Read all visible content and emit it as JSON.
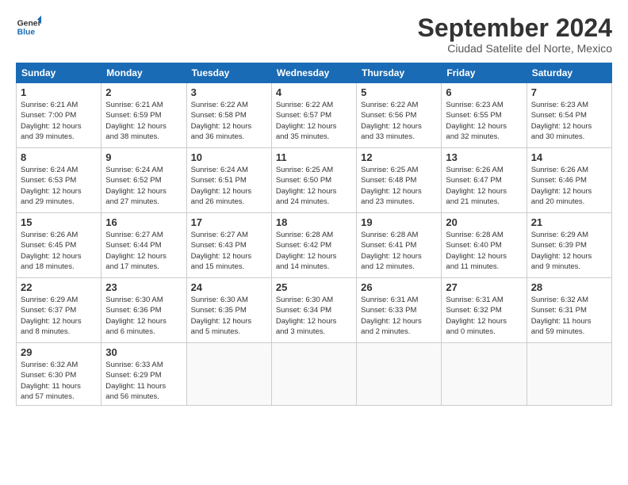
{
  "logo": {
    "line1": "General",
    "line2": "Blue"
  },
  "title": "September 2024",
  "location": "Ciudad Satelite del Norte, Mexico",
  "days_header": [
    "Sunday",
    "Monday",
    "Tuesday",
    "Wednesday",
    "Thursday",
    "Friday",
    "Saturday"
  ],
  "weeks": [
    [
      {
        "num": "1",
        "info": "Sunrise: 6:21 AM\nSunset: 7:00 PM\nDaylight: 12 hours\nand 39 minutes."
      },
      {
        "num": "2",
        "info": "Sunrise: 6:21 AM\nSunset: 6:59 PM\nDaylight: 12 hours\nand 38 minutes."
      },
      {
        "num": "3",
        "info": "Sunrise: 6:22 AM\nSunset: 6:58 PM\nDaylight: 12 hours\nand 36 minutes."
      },
      {
        "num": "4",
        "info": "Sunrise: 6:22 AM\nSunset: 6:57 PM\nDaylight: 12 hours\nand 35 minutes."
      },
      {
        "num": "5",
        "info": "Sunrise: 6:22 AM\nSunset: 6:56 PM\nDaylight: 12 hours\nand 33 minutes."
      },
      {
        "num": "6",
        "info": "Sunrise: 6:23 AM\nSunset: 6:55 PM\nDaylight: 12 hours\nand 32 minutes."
      },
      {
        "num": "7",
        "info": "Sunrise: 6:23 AM\nSunset: 6:54 PM\nDaylight: 12 hours\nand 30 minutes."
      }
    ],
    [
      {
        "num": "8",
        "info": "Sunrise: 6:24 AM\nSunset: 6:53 PM\nDaylight: 12 hours\nand 29 minutes."
      },
      {
        "num": "9",
        "info": "Sunrise: 6:24 AM\nSunset: 6:52 PM\nDaylight: 12 hours\nand 27 minutes."
      },
      {
        "num": "10",
        "info": "Sunrise: 6:24 AM\nSunset: 6:51 PM\nDaylight: 12 hours\nand 26 minutes."
      },
      {
        "num": "11",
        "info": "Sunrise: 6:25 AM\nSunset: 6:50 PM\nDaylight: 12 hours\nand 24 minutes."
      },
      {
        "num": "12",
        "info": "Sunrise: 6:25 AM\nSunset: 6:48 PM\nDaylight: 12 hours\nand 23 minutes."
      },
      {
        "num": "13",
        "info": "Sunrise: 6:26 AM\nSunset: 6:47 PM\nDaylight: 12 hours\nand 21 minutes."
      },
      {
        "num": "14",
        "info": "Sunrise: 6:26 AM\nSunset: 6:46 PM\nDaylight: 12 hours\nand 20 minutes."
      }
    ],
    [
      {
        "num": "15",
        "info": "Sunrise: 6:26 AM\nSunset: 6:45 PM\nDaylight: 12 hours\nand 18 minutes."
      },
      {
        "num": "16",
        "info": "Sunrise: 6:27 AM\nSunset: 6:44 PM\nDaylight: 12 hours\nand 17 minutes."
      },
      {
        "num": "17",
        "info": "Sunrise: 6:27 AM\nSunset: 6:43 PM\nDaylight: 12 hours\nand 15 minutes."
      },
      {
        "num": "18",
        "info": "Sunrise: 6:28 AM\nSunset: 6:42 PM\nDaylight: 12 hours\nand 14 minutes."
      },
      {
        "num": "19",
        "info": "Sunrise: 6:28 AM\nSunset: 6:41 PM\nDaylight: 12 hours\nand 12 minutes."
      },
      {
        "num": "20",
        "info": "Sunrise: 6:28 AM\nSunset: 6:40 PM\nDaylight: 12 hours\nand 11 minutes."
      },
      {
        "num": "21",
        "info": "Sunrise: 6:29 AM\nSunset: 6:39 PM\nDaylight: 12 hours\nand 9 minutes."
      }
    ],
    [
      {
        "num": "22",
        "info": "Sunrise: 6:29 AM\nSunset: 6:37 PM\nDaylight: 12 hours\nand 8 minutes."
      },
      {
        "num": "23",
        "info": "Sunrise: 6:30 AM\nSunset: 6:36 PM\nDaylight: 12 hours\nand 6 minutes."
      },
      {
        "num": "24",
        "info": "Sunrise: 6:30 AM\nSunset: 6:35 PM\nDaylight: 12 hours\nand 5 minutes."
      },
      {
        "num": "25",
        "info": "Sunrise: 6:30 AM\nSunset: 6:34 PM\nDaylight: 12 hours\nand 3 minutes."
      },
      {
        "num": "26",
        "info": "Sunrise: 6:31 AM\nSunset: 6:33 PM\nDaylight: 12 hours\nand 2 minutes."
      },
      {
        "num": "27",
        "info": "Sunrise: 6:31 AM\nSunset: 6:32 PM\nDaylight: 12 hours\nand 0 minutes."
      },
      {
        "num": "28",
        "info": "Sunrise: 6:32 AM\nSunset: 6:31 PM\nDaylight: 11 hours\nand 59 minutes."
      }
    ],
    [
      {
        "num": "29",
        "info": "Sunrise: 6:32 AM\nSunset: 6:30 PM\nDaylight: 11 hours\nand 57 minutes."
      },
      {
        "num": "30",
        "info": "Sunrise: 6:33 AM\nSunset: 6:29 PM\nDaylight: 11 hours\nand 56 minutes."
      },
      {
        "num": "",
        "info": ""
      },
      {
        "num": "",
        "info": ""
      },
      {
        "num": "",
        "info": ""
      },
      {
        "num": "",
        "info": ""
      },
      {
        "num": "",
        "info": ""
      }
    ]
  ]
}
